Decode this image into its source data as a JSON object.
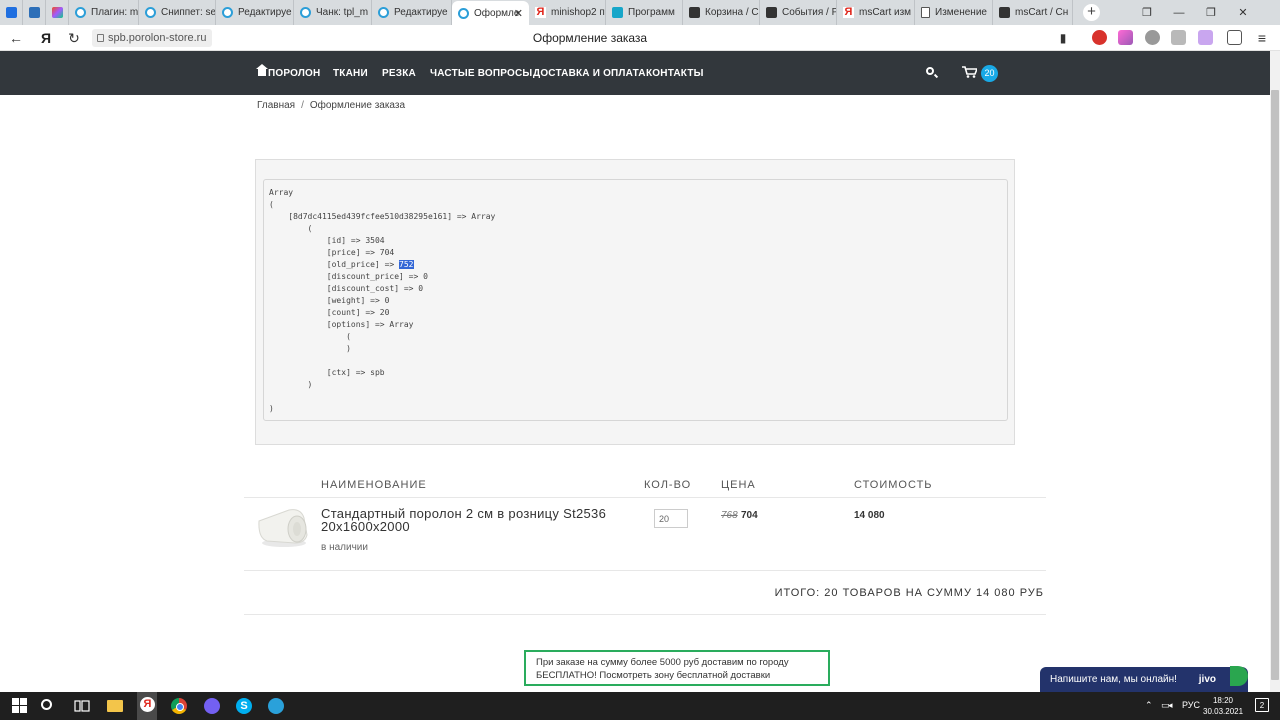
{
  "browser": {
    "tabs": [
      {
        "label": "",
        "favicon": "mail-icon"
      },
      {
        "label": "",
        "favicon": "vk-icon"
      },
      {
        "label": "",
        "favicon": "figma-icon"
      },
      {
        "label": "Плагин: ms",
        "favicon": "modx-icon"
      },
      {
        "label": "Сниппет: se",
        "favicon": "modx-icon"
      },
      {
        "label": "Редактируе",
        "favicon": "modx-icon"
      },
      {
        "label": "Чанк: tpl_m",
        "favicon": "modx-icon"
      },
      {
        "label": "Редактируе",
        "favicon": "modx-icon"
      },
      {
        "label": "Оформле",
        "favicon": "modx-icon",
        "active": true
      },
      {
        "label": "minishop2 п",
        "favicon": "yandex-icon"
      },
      {
        "label": "Программ",
        "favicon": "tilda-icon"
      },
      {
        "label": "Корзина / С",
        "favicon": "x-icon"
      },
      {
        "label": "События / Р",
        "favicon": "x-icon"
      },
      {
        "label": "msCart изм",
        "favicon": "yandex-icon"
      },
      {
        "label": "Изменение",
        "favicon": "doc-icon"
      },
      {
        "label": "msCart / Сн",
        "favicon": "x-icon"
      }
    ],
    "url": "spb.porolon-store.ru",
    "page_title": "Оформление заказа"
  },
  "site": {
    "menu": [
      "ПОРОЛОН",
      "ТКАНИ",
      "РЕЗКА",
      "ЧАСТЫЕ ВОПРОСЫ",
      "ДОСТАВКА И ОПЛАТА",
      "КОНТАКТЫ"
    ],
    "cart_count": "20"
  },
  "breadcrumb": {
    "home": "Главная",
    "separator": "/",
    "current": "Оформление заказа"
  },
  "debug": {
    "lines": [
      "Array",
      "(",
      "    [8d7dc4115ed439fcfee510d38295e161] => Array",
      "        (",
      "            [id] => 3504",
      "            [price] => 704",
      "            [old_price] => ",
      "            [discount_price] => 0",
      "            [discount_cost] => 0",
      "            [weight] => 0",
      "            [count] => 20",
      "            [options] => Array",
      "                (",
      "                )",
      "",
      "            [ctx] => spb",
      "        )",
      "",
      ")"
    ],
    "highlighted_value": "752"
  },
  "cart": {
    "headers": {
      "name": "Наименование",
      "qty": "Кол-во",
      "price": "Цена",
      "cost": "Стоимость"
    },
    "product": {
      "name": "Стандартный поролон 2 см в розницу St2536 20х1600х2000",
      "stock": "в наличии",
      "qty": "20",
      "old_price": "768",
      "price": "704",
      "cost": "14 080"
    },
    "total": "Итого: 20 товаров на сумму 14 080 руб"
  },
  "delivery_note": {
    "line1": "При заказе на сумму более 5000 руб доставим по городу",
    "line2": "БЕСПЛАТНО! Посмотреть зону бесплатной доставки"
  },
  "jivo": {
    "text": "Напишите нам, мы онлайн!",
    "brand": "jivo"
  },
  "taskbar": {
    "lang": "РУС",
    "time": "18:20",
    "date": "30.03.2021",
    "notifications": "2"
  },
  "colors": {
    "header_bg": "#32373c",
    "accent_blue": "#19a9e6",
    "note_border": "#2aac5d",
    "jivo_bg": "#23336b"
  }
}
